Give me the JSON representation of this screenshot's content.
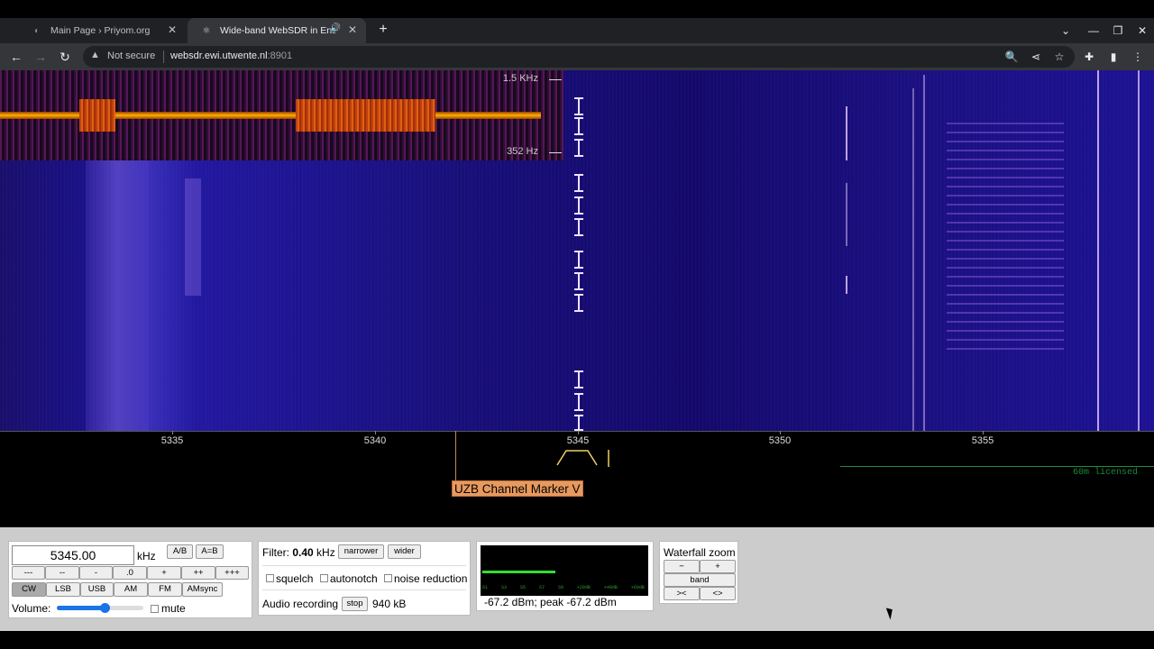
{
  "browser": {
    "tabs": [
      {
        "title": "Main Page › Priyom.org",
        "active": false
      },
      {
        "title": "Wide-band WebSDR in Ensc",
        "active": true
      }
    ],
    "url_warning": "Not secure",
    "url_host": "websdr.ewi.utwente.nl",
    "url_port": ":8901"
  },
  "waterfall": {
    "zoom_labels": {
      "top": "1.5  KHz",
      "bottom": "352  Hz"
    },
    "freq_scale": [
      {
        "label": "5335"
      },
      {
        "label": "5340"
      },
      {
        "label": "5345"
      },
      {
        "label": "5350"
      },
      {
        "label": "5355"
      }
    ],
    "channel_marker": "UZB Channel Marker V",
    "band_label": "60m licensed"
  },
  "controls": {
    "frequency": "5345.00",
    "frequency_unit": "kHz",
    "ab_label": "A/B",
    "aeqb_label": "A=B",
    "step_buttons": [
      "---",
      "--",
      "-",
      ".0",
      "+",
      "++",
      "+++"
    ],
    "modes": [
      "CW",
      "LSB",
      "USB",
      "AM",
      "FM",
      "AMsync"
    ],
    "selected_mode": "CW",
    "volume_label": "Volume:",
    "volume_fraction": 0.55,
    "mute_label": "mute"
  },
  "filter": {
    "prefix": "Filter:",
    "value": "0.40",
    "unit": "kHz",
    "narrower": "narrower",
    "wider": "wider",
    "squelch": "squelch",
    "autonotch": "autonotch",
    "noise_reduction": "noise reduction",
    "audio_recording": "Audio recording",
    "stop": "stop",
    "recorded_size": "940 kB"
  },
  "smeter": {
    "scale": [
      "S1",
      "S3",
      "S5",
      "S7",
      "S9",
      "+20dB",
      "+40dB",
      "+60dB"
    ],
    "level_fraction": 0.45,
    "reading": "-67.2 dBm; peak  -67.2 dBm"
  },
  "waterfall_zoom": {
    "title": "Waterfall zoom",
    "minus": "−",
    "plus": "+",
    "band": "band",
    "shrink": "><",
    "expand": "<>"
  }
}
